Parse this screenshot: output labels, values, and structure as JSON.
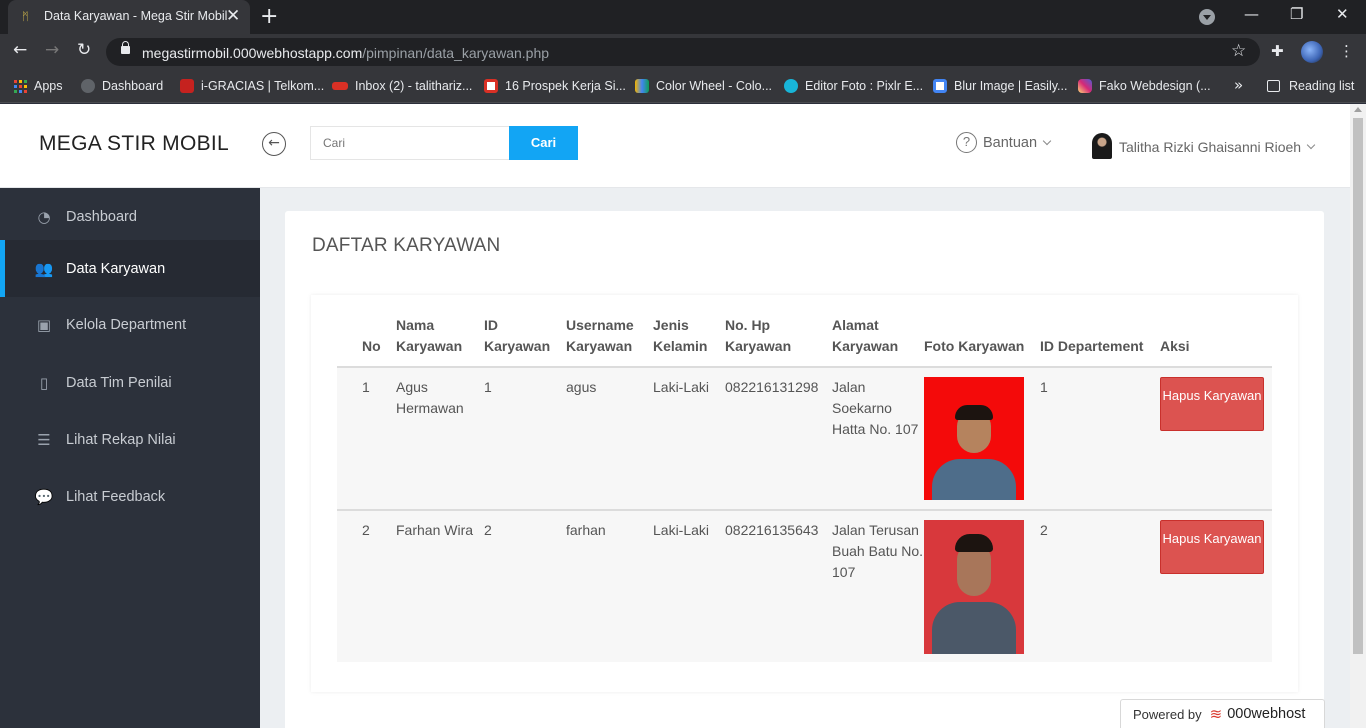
{
  "browser": {
    "tab_title": "Data Karyawan - Mega Stir Mobil",
    "url_host": "megastirmobil.000webhostapp.com",
    "url_path": "/pimpinan/data_karyawan.php",
    "bookmarks": [
      {
        "label": "Apps",
        "icon": "apps-grid-icon"
      },
      {
        "label": "Dashboard",
        "icon": "dashboard-favicon"
      },
      {
        "label": "i-GRACIAS | Telkom...",
        "icon": "igracias-favicon"
      },
      {
        "label": "Inbox (2) - talithariz...",
        "icon": "mail-favicon"
      },
      {
        "label": "16 Prospek Kerja Si...",
        "icon": "home-favicon"
      },
      {
        "label": "Color Wheel - Colo...",
        "icon": "color-wheel-favicon"
      },
      {
        "label": "Editor Foto : Pixlr E...",
        "icon": "pixlr-favicon"
      },
      {
        "label": "Blur Image | Easily...",
        "icon": "blur-favicon"
      },
      {
        "label": "Fako Webdesign (...",
        "icon": "instagram-favicon"
      }
    ],
    "bookmarks_more": "»",
    "reading_list": "Reading list"
  },
  "header": {
    "brand": "MEGA STIR MOBIL",
    "search_placeholder": "Cari",
    "search_button": "Cari",
    "help_label": "Bantuan",
    "user_name": "Talitha Rizki Ghaisanni Rioeh"
  },
  "sidebar": {
    "items": [
      {
        "label": "Dashboard",
        "icon": "dashboard-icon"
      },
      {
        "label": "Data Karyawan",
        "icon": "users-icon"
      },
      {
        "label": "Kelola Department",
        "icon": "briefcase-icon"
      },
      {
        "label": "Data Tim Penilai",
        "icon": "file-icon"
      },
      {
        "label": "Lihat Rekap Nilai",
        "icon": "list-icon"
      },
      {
        "label": "Lihat Feedback",
        "icon": "comments-icon"
      }
    ],
    "active_index": 1
  },
  "main": {
    "title": "DAFTAR KARYAWAN",
    "columns": [
      "No",
      "Nama Karyawan",
      "ID Karyawan",
      "Username Karyawan",
      "Jenis Kelamin",
      "No. Hp Karyawan",
      "Alamat Karyawan",
      "Foto Karyawan",
      "ID Departement",
      "Aksi"
    ],
    "rows": [
      {
        "no": "1",
        "nama": "Agus Hermawan",
        "id": "1",
        "username": "agus",
        "jenis_kelamin": "Laki-Laki",
        "hp": "082216131298",
        "alamat": "Jalan Soekarno Hatta No. 107",
        "id_dept": "1",
        "aksi": "Hapus Karyawan",
        "photo_bg": "#f40a0a"
      },
      {
        "no": "2",
        "nama": "Farhan Wira",
        "id": "2",
        "username": "farhan",
        "jenis_kelamin": "Laki-Laki",
        "hp": "082216135643",
        "alamat": "Jalan Terusan Buah Batu No. 107",
        "id_dept": "2",
        "aksi": "Hapus Karyawan",
        "photo_bg": "#d8383c"
      }
    ]
  },
  "footer": {
    "powered_by": "Powered by",
    "host_brand": "000webhost"
  },
  "colors": {
    "accent": "#12a5f4",
    "sidebar_bg": "#2c313b",
    "danger": "#dc5350"
  }
}
